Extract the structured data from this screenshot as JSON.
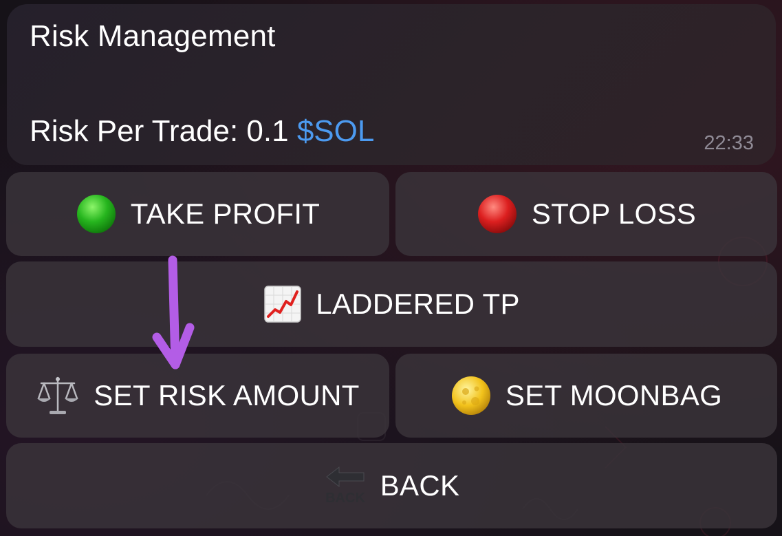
{
  "message": {
    "title": "Risk Management",
    "risk_prefix": "Risk Per Trade: 0.1 ",
    "risk_ticker": "$SOL",
    "time": "22:33"
  },
  "buttons": {
    "take_profit": {
      "label": "TAKE PROFIT",
      "icon": "green-circle-icon"
    },
    "stop_loss": {
      "label": "STOP LOSS",
      "icon": "red-circle-icon"
    },
    "laddered_tp": {
      "label": "LADDERED TP",
      "icon": "chart-increasing-icon"
    },
    "set_risk_amount": {
      "label": "SET RISK AMOUNT",
      "icon": "balance-scale-icon"
    },
    "set_moonbag": {
      "label": "SET MOONBAG",
      "icon": "full-moon-icon"
    },
    "back": {
      "label": "BACK",
      "icon": "back-arrow-icon",
      "icon_text": "BACK"
    }
  },
  "colors": {
    "ticker": "#4c9af0",
    "annotation_arrow": "#b35de6",
    "green_dot": "#22b41c",
    "red_dot": "#d81d1d"
  }
}
